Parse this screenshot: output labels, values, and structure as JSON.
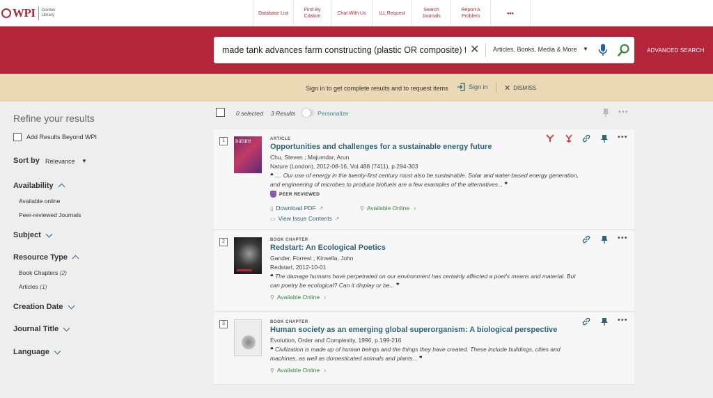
{
  "header": {
    "logo_text": "WPI",
    "library_line1": "Gordon",
    "library_line2": "Library",
    "nav": [
      {
        "label": "Database List"
      },
      {
        "label": "Find By Citation"
      },
      {
        "label": "Chat With Us"
      },
      {
        "label": "ILL Request"
      },
      {
        "label": "Search Journals"
      },
      {
        "label": "Report A Problem"
      },
      {
        "label": "•••"
      }
    ]
  },
  "search": {
    "query": "made tank advances farm constructing (plastic OR composite) fiber",
    "scope": "Articles, Books, Media & More",
    "advanced_label": "ADVANCED SEARCH"
  },
  "banner": {
    "message": "Sign in to get complete results and to request items",
    "signin_label": "Sign in",
    "dismiss_label": "DISMISS"
  },
  "sidebar": {
    "refine_title": "Refine your results",
    "beyond_label": "Add Results Beyond WPI",
    "sort_label": "Sort by",
    "sort_value": "Relevance",
    "availability": "Availability",
    "avail_opt1": "Available online",
    "avail_opt2": "Peer-reviewed Journals",
    "subject": "Subject",
    "resource_type": "Resource Type",
    "rt_opt1": "Book Chapters",
    "rt_opt1_count": "(2)",
    "rt_opt2": "Articles",
    "rt_opt2_count": "(1)",
    "creation_date": "Creation Date",
    "journal_title": "Journal Title",
    "language": "Language"
  },
  "results_header": {
    "selected": "0 selected",
    "count": "3 Results",
    "personalize": "Personalize"
  },
  "results": [
    {
      "num": "1",
      "type": "ARTICLE",
      "title": "Opportunities and challenges for a sustainable energy future",
      "authors": "Chu, Steven ; Majumdar, Arun",
      "source": "Nature (London), 2012-08-16, Vol.488 (7411), p.294-303",
      "snippet1": ".... Our use of energy in the twenty-first century must also be sustainable. Solar and water-based energy generation,",
      "snippet2": "and engineering of microbes to produce biofuels are a few examples of the alternatives...",
      "peer": "PEER REVIEWED",
      "download": "Download PDF",
      "available": "Available Online",
      "issue": "View Issue Contents",
      "thumb_text": "nature"
    },
    {
      "num": "2",
      "type": "BOOK CHAPTER",
      "title": "Redstart: An Ecological Poetics",
      "authors": "Gander, Forrest ; Kinsella, John",
      "source": "Redstart, 2012-10-01",
      "snippet1": "The damage humans have perpetrated on our environment has certainly affected a poet's means and material. But",
      "snippet2": "can poetry be ecological? Can it display or be...",
      "available": "Available Online"
    },
    {
      "num": "3",
      "type": "BOOK CHAPTER",
      "title": "Human society as an emerging global superorganism: A biological perspective",
      "source": "Evolution, Order and Complexity, 1996, p.199-216",
      "snippet1": "Civilization is made up of human beings and the things they have created. These include buildings, cities and",
      "snippet2": "machines, as well as domesticated animals and plants...",
      "available": "Available Online"
    }
  ],
  "colors": {
    "brand": "#b5263a",
    "link": "#2d6576",
    "available": "#3a8a3a",
    "banner": "#ead9b4"
  }
}
